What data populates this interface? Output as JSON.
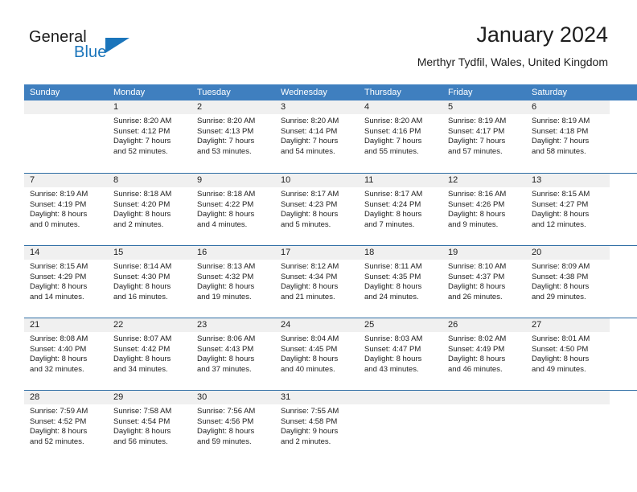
{
  "brand": {
    "name_part1": "General",
    "name_part2": "Blue",
    "accent_color": "#1b75bb"
  },
  "header": {
    "title": "January 2024",
    "subtitle": "Merthyr Tydfil, Wales, United Kingdom"
  },
  "theme": {
    "header_row_bg": "#3f7fbf",
    "week_rule": "#2e6da4",
    "daynum_band": "#f0f0f0",
    "text": "#1d1d1d"
  },
  "weekdays": [
    "Sunday",
    "Monday",
    "Tuesday",
    "Wednesday",
    "Thursday",
    "Friday",
    "Saturday"
  ],
  "weeks": [
    [
      {
        "day": "",
        "lines": []
      },
      {
        "day": "1",
        "lines": [
          "Sunrise: 8:20 AM",
          "Sunset: 4:12 PM",
          "Daylight: 7 hours",
          "and 52 minutes."
        ]
      },
      {
        "day": "2",
        "lines": [
          "Sunrise: 8:20 AM",
          "Sunset: 4:13 PM",
          "Daylight: 7 hours",
          "and 53 minutes."
        ]
      },
      {
        "day": "3",
        "lines": [
          "Sunrise: 8:20 AM",
          "Sunset: 4:14 PM",
          "Daylight: 7 hours",
          "and 54 minutes."
        ]
      },
      {
        "day": "4",
        "lines": [
          "Sunrise: 8:20 AM",
          "Sunset: 4:16 PM",
          "Daylight: 7 hours",
          "and 55 minutes."
        ]
      },
      {
        "day": "5",
        "lines": [
          "Sunrise: 8:19 AM",
          "Sunset: 4:17 PM",
          "Daylight: 7 hours",
          "and 57 minutes."
        ]
      },
      {
        "day": "6",
        "lines": [
          "Sunrise: 8:19 AM",
          "Sunset: 4:18 PM",
          "Daylight: 7 hours",
          "and 58 minutes."
        ]
      }
    ],
    [
      {
        "day": "7",
        "lines": [
          "Sunrise: 8:19 AM",
          "Sunset: 4:19 PM",
          "Daylight: 8 hours",
          "and 0 minutes."
        ]
      },
      {
        "day": "8",
        "lines": [
          "Sunrise: 8:18 AM",
          "Sunset: 4:20 PM",
          "Daylight: 8 hours",
          "and 2 minutes."
        ]
      },
      {
        "day": "9",
        "lines": [
          "Sunrise: 8:18 AM",
          "Sunset: 4:22 PM",
          "Daylight: 8 hours",
          "and 4 minutes."
        ]
      },
      {
        "day": "10",
        "lines": [
          "Sunrise: 8:17 AM",
          "Sunset: 4:23 PM",
          "Daylight: 8 hours",
          "and 5 minutes."
        ]
      },
      {
        "day": "11",
        "lines": [
          "Sunrise: 8:17 AM",
          "Sunset: 4:24 PM",
          "Daylight: 8 hours",
          "and 7 minutes."
        ]
      },
      {
        "day": "12",
        "lines": [
          "Sunrise: 8:16 AM",
          "Sunset: 4:26 PM",
          "Daylight: 8 hours",
          "and 9 minutes."
        ]
      },
      {
        "day": "13",
        "lines": [
          "Sunrise: 8:15 AM",
          "Sunset: 4:27 PM",
          "Daylight: 8 hours",
          "and 12 minutes."
        ]
      }
    ],
    [
      {
        "day": "14",
        "lines": [
          "Sunrise: 8:15 AM",
          "Sunset: 4:29 PM",
          "Daylight: 8 hours",
          "and 14 minutes."
        ]
      },
      {
        "day": "15",
        "lines": [
          "Sunrise: 8:14 AM",
          "Sunset: 4:30 PM",
          "Daylight: 8 hours",
          "and 16 minutes."
        ]
      },
      {
        "day": "16",
        "lines": [
          "Sunrise: 8:13 AM",
          "Sunset: 4:32 PM",
          "Daylight: 8 hours",
          "and 19 minutes."
        ]
      },
      {
        "day": "17",
        "lines": [
          "Sunrise: 8:12 AM",
          "Sunset: 4:34 PM",
          "Daylight: 8 hours",
          "and 21 minutes."
        ]
      },
      {
        "day": "18",
        "lines": [
          "Sunrise: 8:11 AM",
          "Sunset: 4:35 PM",
          "Daylight: 8 hours",
          "and 24 minutes."
        ]
      },
      {
        "day": "19",
        "lines": [
          "Sunrise: 8:10 AM",
          "Sunset: 4:37 PM",
          "Daylight: 8 hours",
          "and 26 minutes."
        ]
      },
      {
        "day": "20",
        "lines": [
          "Sunrise: 8:09 AM",
          "Sunset: 4:38 PM",
          "Daylight: 8 hours",
          "and 29 minutes."
        ]
      }
    ],
    [
      {
        "day": "21",
        "lines": [
          "Sunrise: 8:08 AM",
          "Sunset: 4:40 PM",
          "Daylight: 8 hours",
          "and 32 minutes."
        ]
      },
      {
        "day": "22",
        "lines": [
          "Sunrise: 8:07 AM",
          "Sunset: 4:42 PM",
          "Daylight: 8 hours",
          "and 34 minutes."
        ]
      },
      {
        "day": "23",
        "lines": [
          "Sunrise: 8:06 AM",
          "Sunset: 4:43 PM",
          "Daylight: 8 hours",
          "and 37 minutes."
        ]
      },
      {
        "day": "24",
        "lines": [
          "Sunrise: 8:04 AM",
          "Sunset: 4:45 PM",
          "Daylight: 8 hours",
          "and 40 minutes."
        ]
      },
      {
        "day": "25",
        "lines": [
          "Sunrise: 8:03 AM",
          "Sunset: 4:47 PM",
          "Daylight: 8 hours",
          "and 43 minutes."
        ]
      },
      {
        "day": "26",
        "lines": [
          "Sunrise: 8:02 AM",
          "Sunset: 4:49 PM",
          "Daylight: 8 hours",
          "and 46 minutes."
        ]
      },
      {
        "day": "27",
        "lines": [
          "Sunrise: 8:01 AM",
          "Sunset: 4:50 PM",
          "Daylight: 8 hours",
          "and 49 minutes."
        ]
      }
    ],
    [
      {
        "day": "28",
        "lines": [
          "Sunrise: 7:59 AM",
          "Sunset: 4:52 PM",
          "Daylight: 8 hours",
          "and 52 minutes."
        ]
      },
      {
        "day": "29",
        "lines": [
          "Sunrise: 7:58 AM",
          "Sunset: 4:54 PM",
          "Daylight: 8 hours",
          "and 56 minutes."
        ]
      },
      {
        "day": "30",
        "lines": [
          "Sunrise: 7:56 AM",
          "Sunset: 4:56 PM",
          "Daylight: 8 hours",
          "and 59 minutes."
        ]
      },
      {
        "day": "31",
        "lines": [
          "Sunrise: 7:55 AM",
          "Sunset: 4:58 PM",
          "Daylight: 9 hours",
          "and 2 minutes."
        ]
      },
      {
        "day": "",
        "lines": []
      },
      {
        "day": "",
        "lines": []
      },
      {
        "day": "",
        "lines": []
      }
    ]
  ]
}
